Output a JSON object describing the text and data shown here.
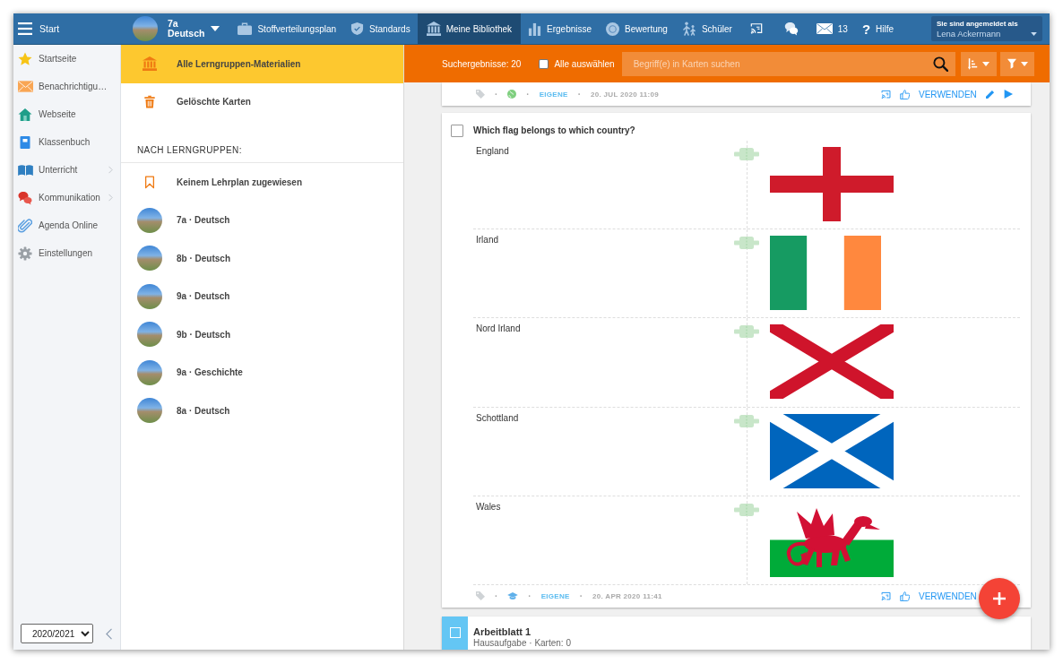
{
  "topbar": {
    "menu": {
      "label": "Start"
    },
    "group": {
      "name": "7a",
      "subject": "Deutsch"
    },
    "items": [
      {
        "kind": "plan",
        "label": "Stoffverteilungsplan",
        "selected": false
      },
      {
        "kind": "standards",
        "label": "Standards",
        "selected": false
      },
      {
        "kind": "library",
        "label": "Meine Bibliothek",
        "selected": true
      },
      {
        "kind": "results",
        "label": "Ergebnisse",
        "selected": false
      },
      {
        "kind": "grading",
        "label": "Bewertung",
        "selected": false
      },
      {
        "kind": "students",
        "label": "Schüler",
        "selected": false
      },
      {
        "kind": "cast",
        "selected": false
      },
      {
        "kind": "chat",
        "selected": false
      },
      {
        "kind": "mail",
        "label": "13",
        "selected": false
      },
      {
        "kind": "help",
        "glyph": "?",
        "label": "Hilfe",
        "selected": false
      }
    ],
    "user": {
      "caption": "Sie sind angemeldet als",
      "name": "Lena Ackermann"
    }
  },
  "sidebar": {
    "items": [
      {
        "kind": "home",
        "label": "Startseite",
        "submenu": false,
        "selected": false
      },
      {
        "kind": "notifications",
        "label": "Benachrichtigu…",
        "submenu": false,
        "selected": false
      },
      {
        "kind": "website",
        "label": "Webseite",
        "submenu": false,
        "selected": false
      },
      {
        "kind": "classbook",
        "label": "Klassenbuch",
        "submenu": false,
        "selected": false
      },
      {
        "kind": "lessons",
        "label": "Unterricht",
        "submenu": true,
        "selected": false
      },
      {
        "kind": "communication",
        "label": "Kommunikation",
        "submenu": true,
        "selected": false
      },
      {
        "kind": "agenda",
        "label": "Agenda Online",
        "submenu": false,
        "selected": false
      },
      {
        "kind": "settings",
        "label": "Einstellungen",
        "submenu": false,
        "selected": false
      }
    ],
    "year": "2020/2021"
  },
  "library_panel": {
    "items": [
      {
        "kind": "all",
        "label": "Alle Lerngruppen-Materialien",
        "selected": true
      },
      {
        "kind": "deleted",
        "label": "Gelöschte Karten",
        "selected": false
      }
    ],
    "heading": "NACH LERNGRUPPEN:",
    "groups": [
      {
        "kind": "unassigned",
        "label": "Keinem Lehrplan zugewiesen",
        "selected": false
      },
      {
        "kind": "group",
        "label": "7a · Deutsch",
        "selected": false
      },
      {
        "kind": "group",
        "label": "8b · Deutsch",
        "selected": false
      },
      {
        "kind": "group",
        "label": "9a · Deutsch",
        "selected": false
      },
      {
        "kind": "group",
        "label": "9b · Deutsch",
        "selected": false
      },
      {
        "kind": "group",
        "label": "9a · Geschichte",
        "selected": false
      },
      {
        "kind": "group",
        "label": "8a · Deutsch",
        "selected": false
      }
    ]
  },
  "toolbar": {
    "results": "Suchergebnisse: 20",
    "select_all": {
      "label": "Alle auswählen",
      "checked": false
    },
    "search": {
      "placeholder": "Begriff(e) in Karten suchen"
    }
  },
  "cards": [
    {
      "kind": "footer",
      "meta": [
        {
          "kind": "tag"
        },
        {
          "kind": "sep",
          "text": "·"
        },
        {
          "kind": "globe"
        },
        {
          "kind": "sep",
          "text": "·"
        },
        {
          "kind": "source",
          "text": "EIGENE"
        },
        {
          "kind": "sep",
          "text": "·"
        },
        {
          "kind": "date",
          "text": "20. JUL 2020 11:09"
        }
      ],
      "actions": [
        {
          "kind": "cast"
        },
        {
          "kind": "like"
        },
        {
          "kind": "use",
          "label": "VERWENDEN"
        },
        {
          "kind": "edit"
        },
        {
          "kind": "play"
        }
      ]
    },
    {
      "kind": "matching",
      "checked": false,
      "title": "Which flag belongs to which country?",
      "pairs": [
        {
          "term": "England",
          "kind": "england"
        },
        {
          "term": "Irland",
          "kind": "ireland"
        },
        {
          "term": "Nord Irland",
          "kind": "northern_ireland"
        },
        {
          "term": "Schottland",
          "kind": "scotland"
        },
        {
          "term": "Wales",
          "kind": "wales"
        }
      ],
      "meta": [
        {
          "kind": "tag"
        },
        {
          "kind": "sep",
          "text": "·"
        },
        {
          "kind": "cap"
        },
        {
          "kind": "sep",
          "text": "·"
        },
        {
          "kind": "source",
          "text": "EIGENE"
        },
        {
          "kind": "sep",
          "text": "·"
        },
        {
          "kind": "date",
          "text": "20. APR 2020 11:41"
        }
      ],
      "actions": [
        {
          "kind": "cast"
        },
        {
          "kind": "like"
        },
        {
          "kind": "use",
          "label": "VERWENDEN"
        }
      ]
    },
    {
      "kind": "worksheet",
      "checked": false,
      "title": "Arbeitblatt 1",
      "subtitle": "Hausaufgabe · Karten: 0"
    }
  ]
}
